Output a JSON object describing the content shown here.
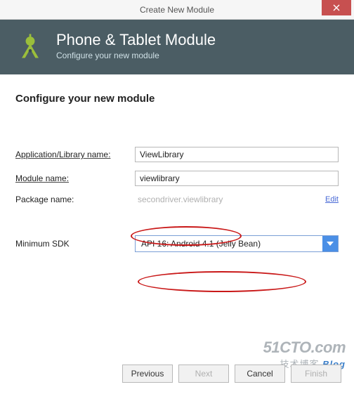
{
  "window": {
    "title": "Create New Module"
  },
  "header": {
    "title": "Phone & Tablet Module",
    "subtitle": "Configure your new module"
  },
  "section": {
    "heading": "Configure your new module"
  },
  "form": {
    "app_name_label": "Application/Library name:",
    "app_name_value": "ViewLibrary",
    "module_name_label": "Module name:",
    "module_name_value": "viewlibrary",
    "package_name_label": "Package name:",
    "package_name_value": "secondriver.viewlibrary",
    "edit_link": "Edit",
    "min_sdk_label": "Minimum SDK",
    "min_sdk_value": "API 16: Android 4.1 (Jelly Bean)"
  },
  "buttons": {
    "previous": "Previous",
    "next": "Next",
    "cancel": "Cancel",
    "finish": "Finish"
  },
  "watermark": {
    "line1": "51CTO.com",
    "line2_a": "技术博客",
    "line2_b": "Blog"
  }
}
